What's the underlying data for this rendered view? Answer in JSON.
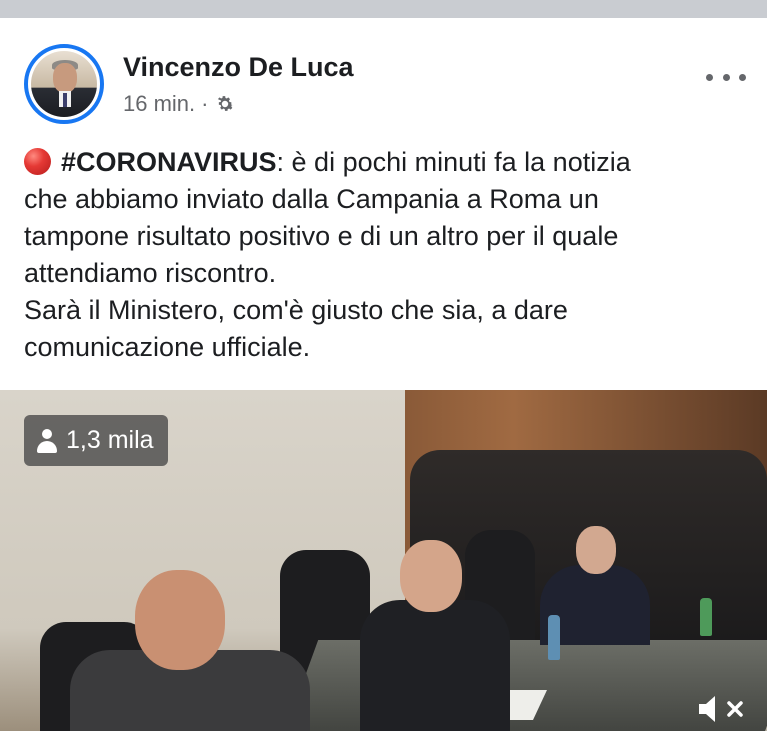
{
  "post": {
    "author": "Vincenzo De Luca",
    "time": "16 min.",
    "separator": "·",
    "privacy_icon": "gear-icon",
    "more_icon": "more-options-icon",
    "text": {
      "marker_icon": "red-circle-icon",
      "hashtag": "#CORONAVIRUS",
      "line1_rest": ": è di pochi minuti fa la notizia",
      "line2": "che abbiamo inviato dalla Campania a Roma un",
      "line3": "tampone risultato positivo e di un altro per il quale",
      "line4": "attendiamo riscontro.",
      "line5": "Sarà il Ministero, com'è giusto che sia, a dare",
      "line6": "comunicazione ufficiale."
    }
  },
  "video": {
    "viewers_icon": "person-icon",
    "viewers": "1,3 mila",
    "mute_icon": "speaker-muted-icon"
  },
  "colors": {
    "accent": "#1877f2",
    "text": "#1c1e21",
    "secondary": "#65676b"
  }
}
